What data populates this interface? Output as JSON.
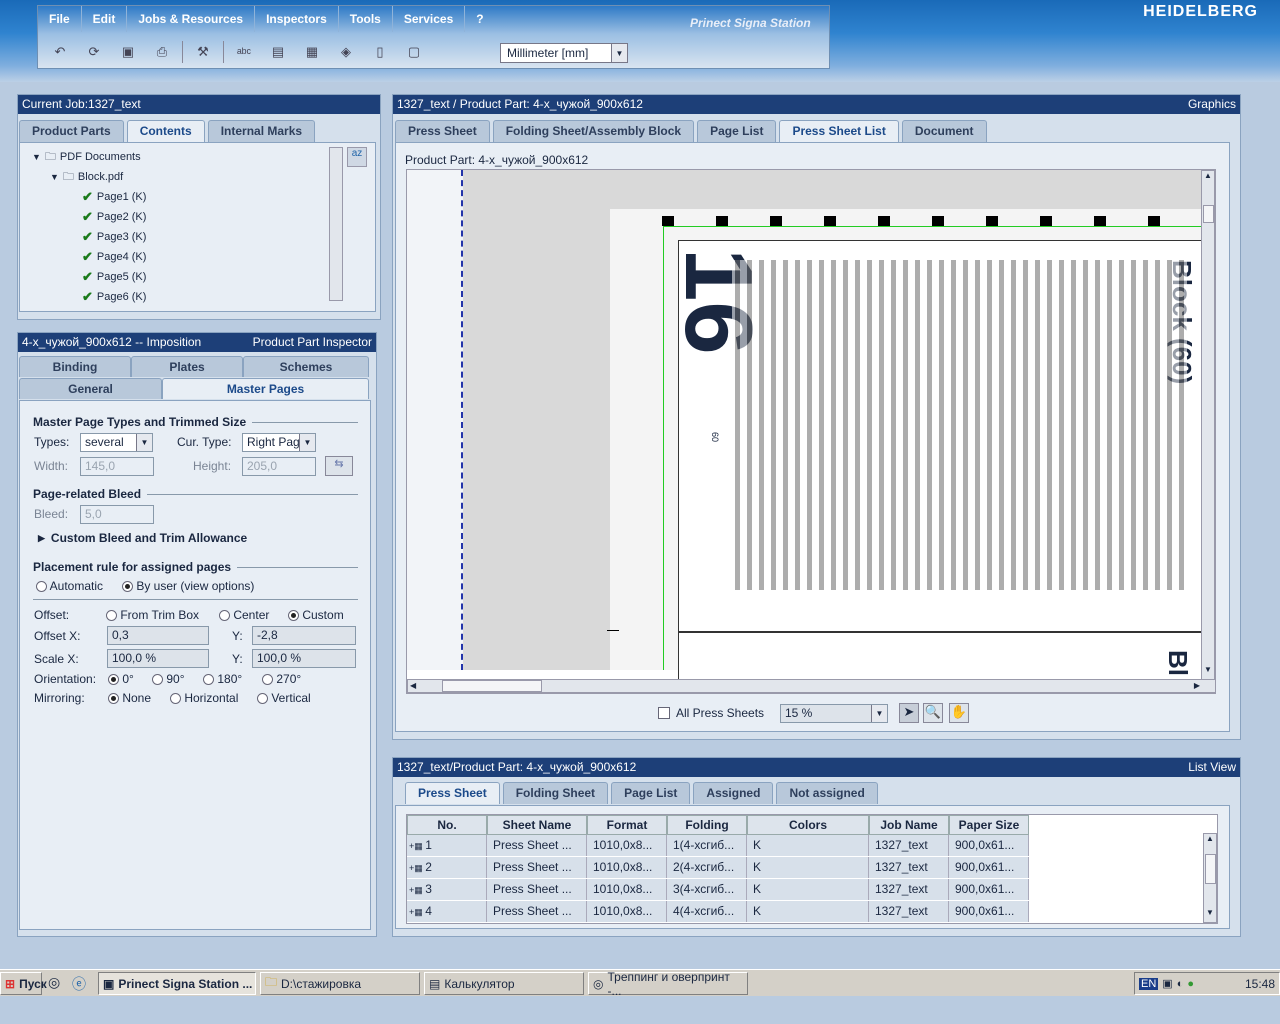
{
  "brand": "HEIDELBERG",
  "product_name": "Prinect Signa Station",
  "menu": [
    "File",
    "Edit",
    "Jobs & Resources",
    "Inspectors",
    "Tools",
    "Services",
    "?"
  ],
  "units": "Millimeter  [mm]",
  "job_panel": {
    "title": "Current Job:1327_text",
    "tabs": [
      "Product Parts",
      "Contents",
      "Internal Marks"
    ],
    "tree": {
      "root": "PDF Documents",
      "file": "Block.pdf",
      "pages": [
        "Page1 (K)",
        "Page2 (K)",
        "Page3 (K)",
        "Page4 (K)",
        "Page5 (K)",
        "Page6 (K)"
      ]
    }
  },
  "inspector": {
    "title_left": "4-х_чужой_900х612 -- Imposition",
    "title_right": "Product Part Inspector",
    "tabs_row1": [
      "Binding",
      "Plates",
      "Schemes"
    ],
    "tabs_row2": [
      "General",
      "Master Pages"
    ],
    "sec_types": "Master Page Types and Trimmed Size",
    "types_label": "Types:",
    "types_value": "several",
    "curtype_label": "Cur. Type:",
    "curtype_value": "Right Pag",
    "width_label": "Width:",
    "width_value": "145,0",
    "height_label": "Height:",
    "height_value": "205,0",
    "sec_bleed": "Page-related Bleed",
    "bleed_label": "Bleed:",
    "bleed_value": "5,0",
    "custom_bleed": "Custom Bleed and Trim Allowance",
    "sec_placement": "Placement rule for assigned pages",
    "automatic": "Automatic",
    "byuser": "By user (view options)",
    "offset_label": "Offset:",
    "from_trim": "From Trim Box",
    "center": "Center",
    "custom": "Custom",
    "offsetx_label": "Offset X:",
    "offsetx_value": "0,3",
    "y_label": "Y:",
    "offsety_value": "-2,8",
    "scalex_label": "Scale X:",
    "scalex_value": "100,0 %",
    "scaley_value": "100,0 %",
    "orientation_label": "Orientation:",
    "orientations": [
      "0°",
      "90°",
      "180°",
      "270°"
    ],
    "mirroring_label": "Mirroring:",
    "mirrors": [
      "None",
      "Horizontal",
      "Vertical"
    ]
  },
  "graphics": {
    "title_left": "1327_text / Product Part: 4-х_чужой_900х612",
    "title_right": "Graphics",
    "tabs": [
      "Press Sheet",
      "Folding Sheet/Assembly Block",
      "Page List",
      "Press Sheet List",
      "Document"
    ],
    "product_part_label": "Product Part: 4-х_чужой_900х612",
    "all_press_sheets": "All Press Sheets",
    "zoom": "15 %",
    "page_number": "16",
    "block_title": "Block (60)",
    "bottom_title": "Bl",
    "folio": "60"
  },
  "list": {
    "title_left": "1327_text/Product Part: 4-х_чужой_900х612",
    "title_right": "List View",
    "tabs": [
      "Press Sheet",
      "Folding Sheet",
      "Page List",
      "Assigned",
      "Not assigned"
    ],
    "columns": [
      "No.",
      "Sheet Name",
      "Format",
      "Folding Sheet",
      "Colors",
      "Job Name",
      "Paper Size"
    ],
    "rows": [
      [
        "1",
        "Press Sheet ...",
        "1010,0x8...",
        "1(4-хсгиб...",
        "K",
        "1327_text",
        "900,0x61..."
      ],
      [
        "2",
        "Press Sheet ...",
        "1010,0x8...",
        "2(4-хсгиб...",
        "K",
        "1327_text",
        "900,0x61..."
      ],
      [
        "3",
        "Press Sheet ...",
        "1010,0x8...",
        "3(4-хсгиб...",
        "K",
        "1327_text",
        "900,0x61..."
      ],
      [
        "4",
        "Press Sheet ...",
        "1010,0x8...",
        "4(4-хсгиб...",
        "K",
        "1327_text",
        "900,0x61..."
      ]
    ]
  },
  "taskbar": {
    "start": "Пуск",
    "tasks": [
      "Prinect Signa Station ...",
      "D:\\стажировка",
      "Калькулятор",
      "Треппинг и оверпринт -..."
    ],
    "lang": "EN",
    "clock": "15:48"
  }
}
